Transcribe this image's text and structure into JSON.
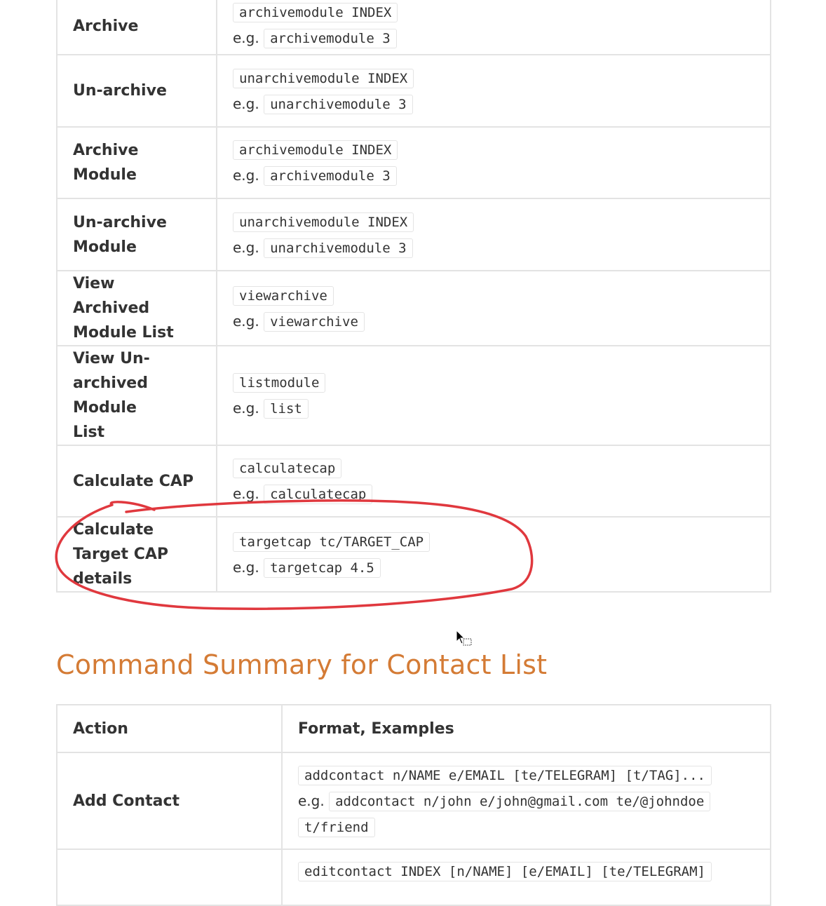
{
  "module_table": {
    "rows": [
      {
        "action": "Archive",
        "format": "archivemodule INDEX",
        "example": "archivemodule 3"
      },
      {
        "action": "Un-archive",
        "format": "unarchivemodule INDEX",
        "example": "unarchivemodule 3"
      },
      {
        "action": "Archive Module",
        "format": "archivemodule INDEX",
        "example": "archivemodule 3"
      },
      {
        "action": "Un-archive Module",
        "format": "unarchivemodule INDEX",
        "example": "unarchivemodule 3"
      },
      {
        "action": "View Archived Module List",
        "format": "viewarchive",
        "example": "viewarchive"
      },
      {
        "action": "View Un-archived Module List",
        "format": "listmodule",
        "example": "list"
      },
      {
        "action": "Calculate CAP",
        "format": "calculatecap",
        "example": "calculatecap"
      },
      {
        "action": "Calculate Target CAP details",
        "format": "targetcap tc/TARGET_CAP",
        "example": "targetcap 4.5"
      }
    ],
    "eg_label": "e.g."
  },
  "contact_section": {
    "heading": "Command Summary for Contact List",
    "headers": [
      "Action",
      "Format, Examples"
    ],
    "rows": [
      {
        "action": "Add Contact",
        "format": "addcontact n/NAME e/EMAIL [te/TELEGRAM] [t/TAG]...",
        "example_a": "addcontact n/john e/john@gmail.com te/@johndoe",
        "example_b": "t/friend"
      },
      {
        "action": "",
        "format": "editcontact INDEX [n/NAME] [e/EMAIL] [te/TELEGRAM]"
      }
    ]
  },
  "colors": {
    "heading": "#d47b35",
    "annotation": "#e0383e",
    "border": "#e3e3e3"
  }
}
